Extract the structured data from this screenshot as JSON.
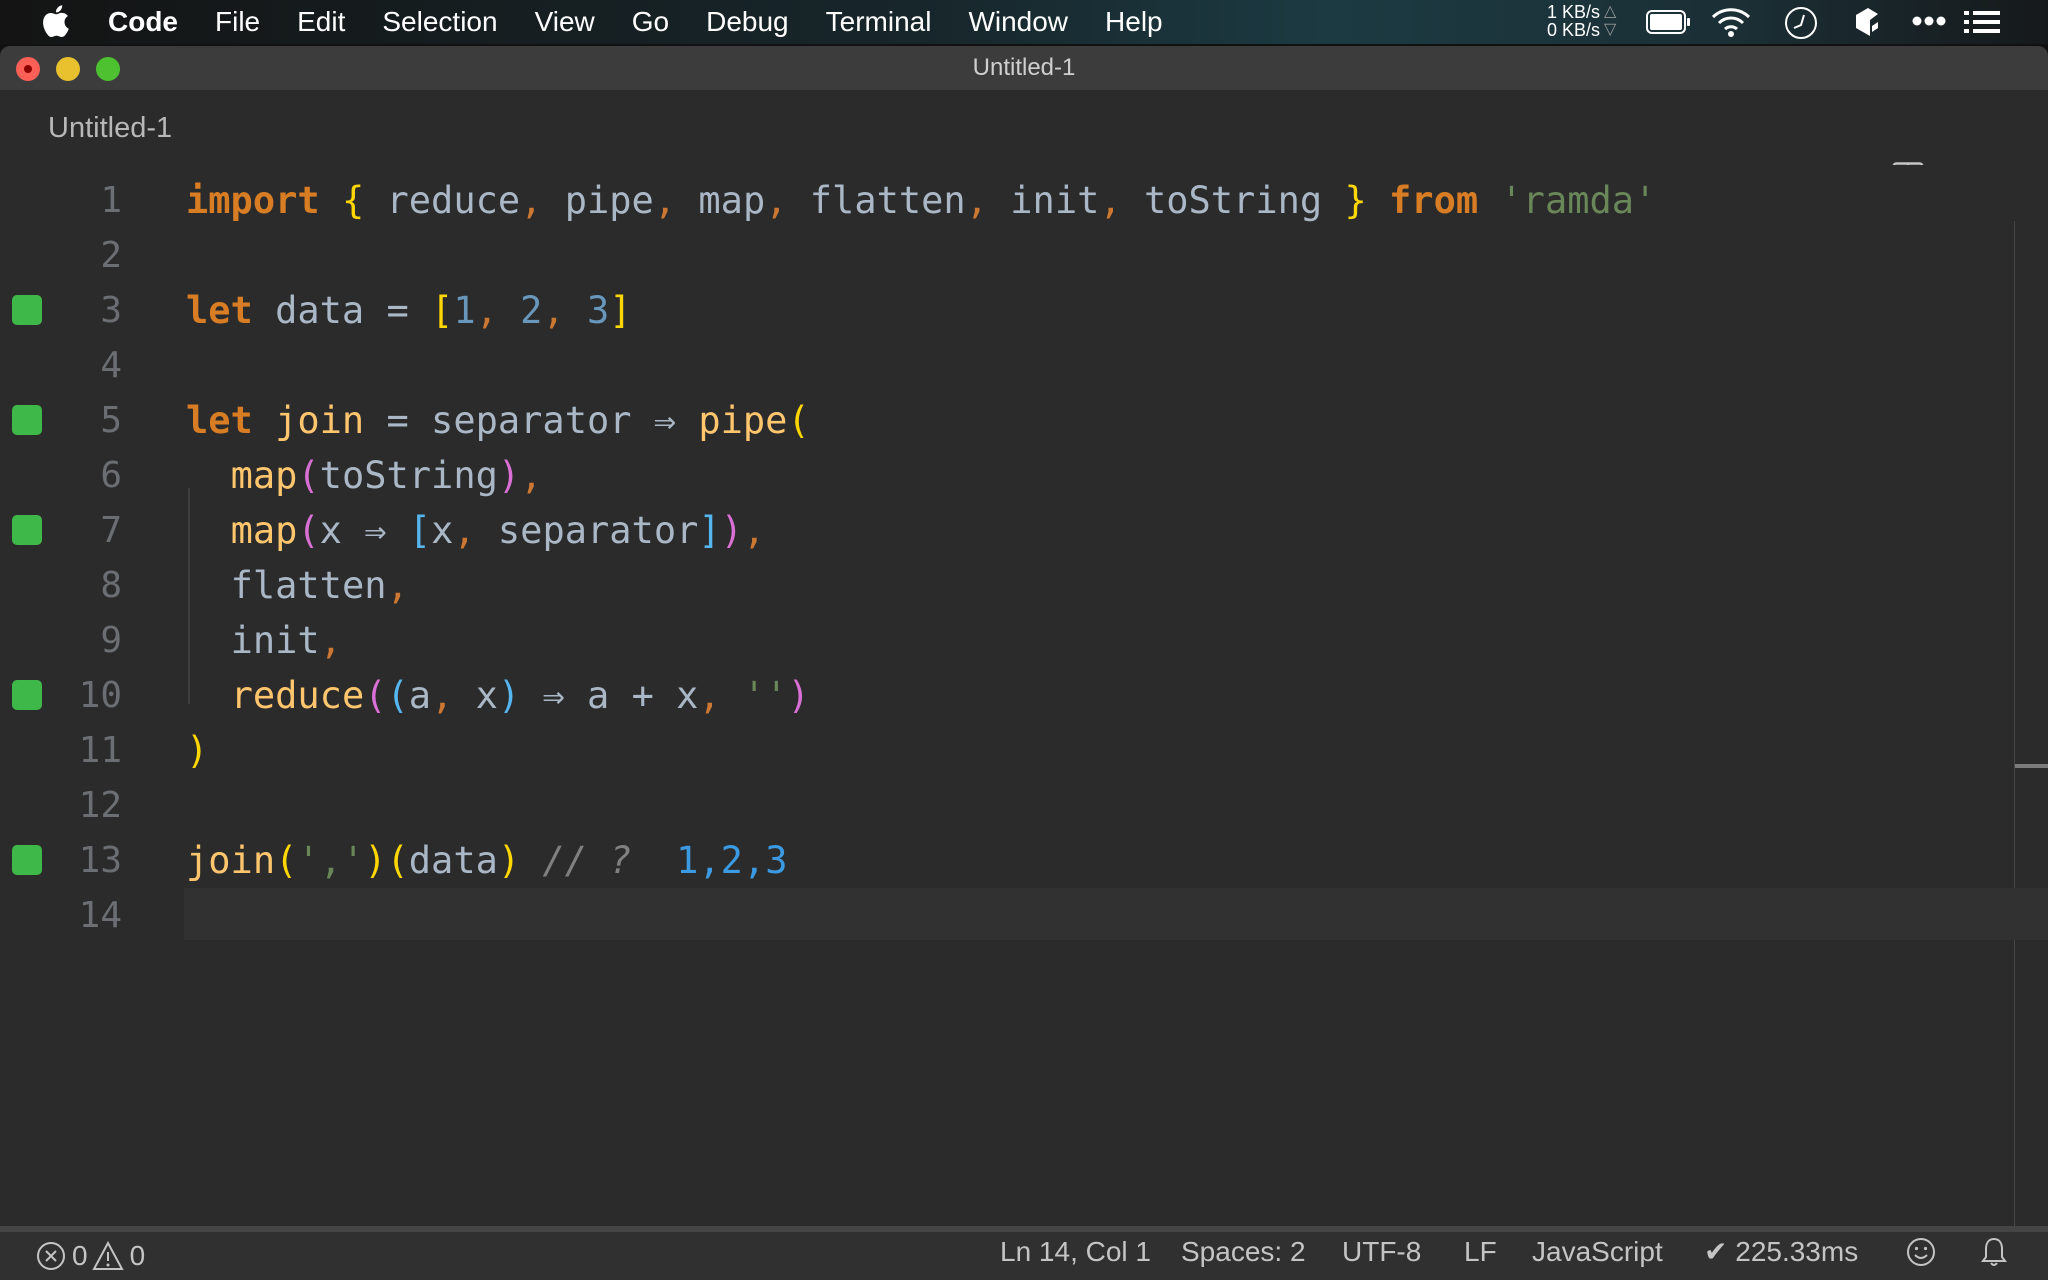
{
  "menubar": {
    "app_name": "Code",
    "items": [
      "File",
      "Edit",
      "Selection",
      "View",
      "Go",
      "Debug",
      "Terminal",
      "Window",
      "Help"
    ],
    "network": {
      "up": "1 KB/s",
      "down": "0 KB/s"
    },
    "tray_icons": [
      "battery-icon",
      "wifi-icon",
      "clock-icon",
      "dropbox-icon",
      "more-icon",
      "list-icon"
    ]
  },
  "window": {
    "title": "Untitled-1"
  },
  "tab": {
    "label": "Untitled-1",
    "dirty": true
  },
  "editor": {
    "current_line": 14,
    "lines": [
      {
        "n": "1",
        "marker": false
      },
      {
        "n": "2",
        "marker": false
      },
      {
        "n": "3",
        "marker": true
      },
      {
        "n": "4",
        "marker": false
      },
      {
        "n": "5",
        "marker": true
      },
      {
        "n": "6",
        "marker": false
      },
      {
        "n": "7",
        "marker": true
      },
      {
        "n": "8",
        "marker": false
      },
      {
        "n": "9",
        "marker": false
      },
      {
        "n": "10",
        "marker": true
      },
      {
        "n": "11",
        "marker": false
      },
      {
        "n": "12",
        "marker": false
      },
      {
        "n": "13",
        "marker": true
      },
      {
        "n": "14",
        "marker": false
      }
    ],
    "tokens": {
      "l1": [
        "import",
        " ",
        "{",
        " ",
        "reduce",
        ",",
        " ",
        "pipe",
        ",",
        " ",
        "map",
        ",",
        " ",
        "flatten",
        ",",
        " ",
        "init",
        ",",
        " ",
        "toString",
        " ",
        "}",
        " ",
        "from",
        " ",
        "'ramda'"
      ],
      "l3": [
        "let",
        " data = ",
        "[",
        "1",
        ",",
        " ",
        "2",
        ",",
        " ",
        "3",
        "]"
      ],
      "l5": [
        "let",
        " ",
        "join",
        " = separator ⇒ ",
        "pipe",
        "("
      ],
      "l6": [
        "  ",
        "map",
        "(",
        "toString",
        ")",
        ","
      ],
      "l7": [
        "  ",
        "map",
        "(",
        "x ⇒ ",
        "[",
        "x",
        ",",
        " separator",
        "]",
        ")",
        ","
      ],
      "l8": [
        "  ",
        "flatten",
        ","
      ],
      "l9": [
        "  ",
        "init",
        ","
      ],
      "l10": [
        "  ",
        "reduce",
        "(",
        "(",
        "a",
        ",",
        " x",
        ")",
        " ⇒ a + x",
        ",",
        " ",
        "''",
        ")"
      ],
      "l11": [
        ")"
      ],
      "l13": [
        "join",
        "(",
        "','",
        ")",
        "(",
        "data",
        ")",
        " ",
        "// ?",
        "  ",
        "1,2,3"
      ]
    }
  },
  "statusbar": {
    "errors": "0",
    "warnings": "0",
    "position": "Ln 14, Col 1",
    "indent": "Spaces: 2",
    "encoding": "UTF-8",
    "eol": "LF",
    "language": "JavaScript",
    "quokka": "✔ 225.33ms"
  }
}
